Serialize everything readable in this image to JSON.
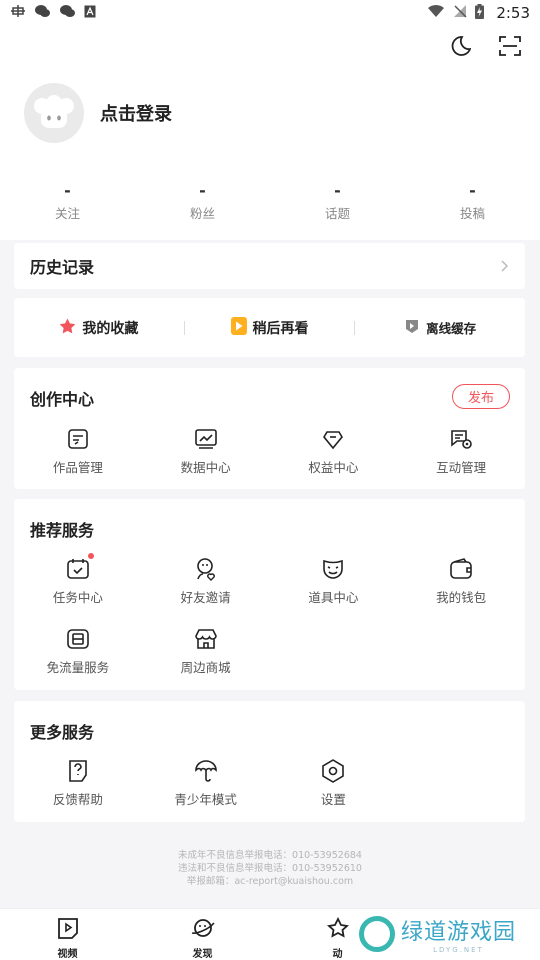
{
  "status_bar": {
    "time": "2:53",
    "left_icons": [
      "bug-icon",
      "wechat-icon",
      "wechat-icon",
      "a-icon"
    ],
    "right_icons": [
      "wifi-icon",
      "signal-off-icon",
      "battery-charging-icon"
    ]
  },
  "header": {
    "moon_icon": "moon-icon",
    "scan_icon": "scan-icon"
  },
  "profile": {
    "login_label": "点击登录"
  },
  "stats": [
    {
      "value": "-",
      "label": "关注"
    },
    {
      "value": "-",
      "label": "粉丝"
    },
    {
      "value": "-",
      "label": "话题"
    },
    {
      "value": "-",
      "label": "投稿"
    }
  ],
  "history": {
    "title": "历史记录",
    "chevron": "›"
  },
  "quick": [
    {
      "label": "我的收藏",
      "icon": "star-icon",
      "color": "#f2545b"
    },
    {
      "label": "稍后再看",
      "icon": "play-later-icon",
      "color": "#ffb020"
    },
    {
      "label": "离线缓存",
      "icon": "download-icon",
      "color": "#888888"
    }
  ],
  "create_center": {
    "title": "创作中心",
    "publish_label": "发布",
    "items": [
      {
        "label": "作品管理",
        "icon": "works-icon"
      },
      {
        "label": "数据中心",
        "icon": "chart-icon"
      },
      {
        "label": "权益中心",
        "icon": "rights-icon"
      },
      {
        "label": "互动管理",
        "icon": "interaction-icon"
      }
    ]
  },
  "recommend": {
    "title": "推荐服务",
    "items": [
      {
        "label": "任务中心",
        "icon": "task-icon"
      },
      {
        "label": "好友邀请",
        "icon": "invite-icon"
      },
      {
        "label": "道具中心",
        "icon": "mask-icon"
      },
      {
        "label": "我的钱包",
        "icon": "wallet-icon"
      },
      {
        "label": "免流量服务",
        "icon": "sim-icon"
      },
      {
        "label": "周边商城",
        "icon": "shop-icon"
      }
    ]
  },
  "more": {
    "title": "更多服务",
    "items": [
      {
        "label": "反馈帮助",
        "icon": "help-icon"
      },
      {
        "label": "青少年模式",
        "icon": "umbrella-icon"
      },
      {
        "label": "设置",
        "icon": "settings-icon"
      }
    ]
  },
  "footer": {
    "line1": "未成年不良信息举报电话：010-53952684",
    "line2": "违法和不良信息举报电话：010-53952610",
    "line3": "举报邮箱：ac-report@kuaishou.com"
  },
  "tabs": [
    {
      "label": "视频",
      "icon": "video-tab-icon"
    },
    {
      "label": "发现",
      "icon": "planet-tab-icon"
    },
    {
      "label": "动",
      "icon": "star-tab-icon"
    }
  ],
  "watermark": {
    "main": "绿道游戏园",
    "sub": "LDYG.NET"
  },
  "colors": {
    "accent": "#f2545b",
    "later": "#ffb020",
    "watermark": "#3aa6c8"
  }
}
